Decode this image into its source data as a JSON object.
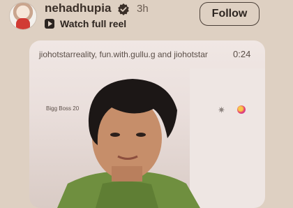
{
  "post": {
    "username": "nehadhupia",
    "time_ago": "3h",
    "watch_reel_label": "Watch full reel",
    "follow_label": "Follow"
  },
  "reel": {
    "caption": "jiohotstarreality, fun.with.gullu.g and jiohotstar",
    "duration": "0:24",
    "show_tag": "Bigg Boss 20"
  },
  "icons": {
    "verified": "verified-badge-icon",
    "reel": "reel-play-icon",
    "sparkle": "sparkle-icon"
  },
  "colors": {
    "background": "#ded0c2",
    "text": "#2d2520"
  }
}
